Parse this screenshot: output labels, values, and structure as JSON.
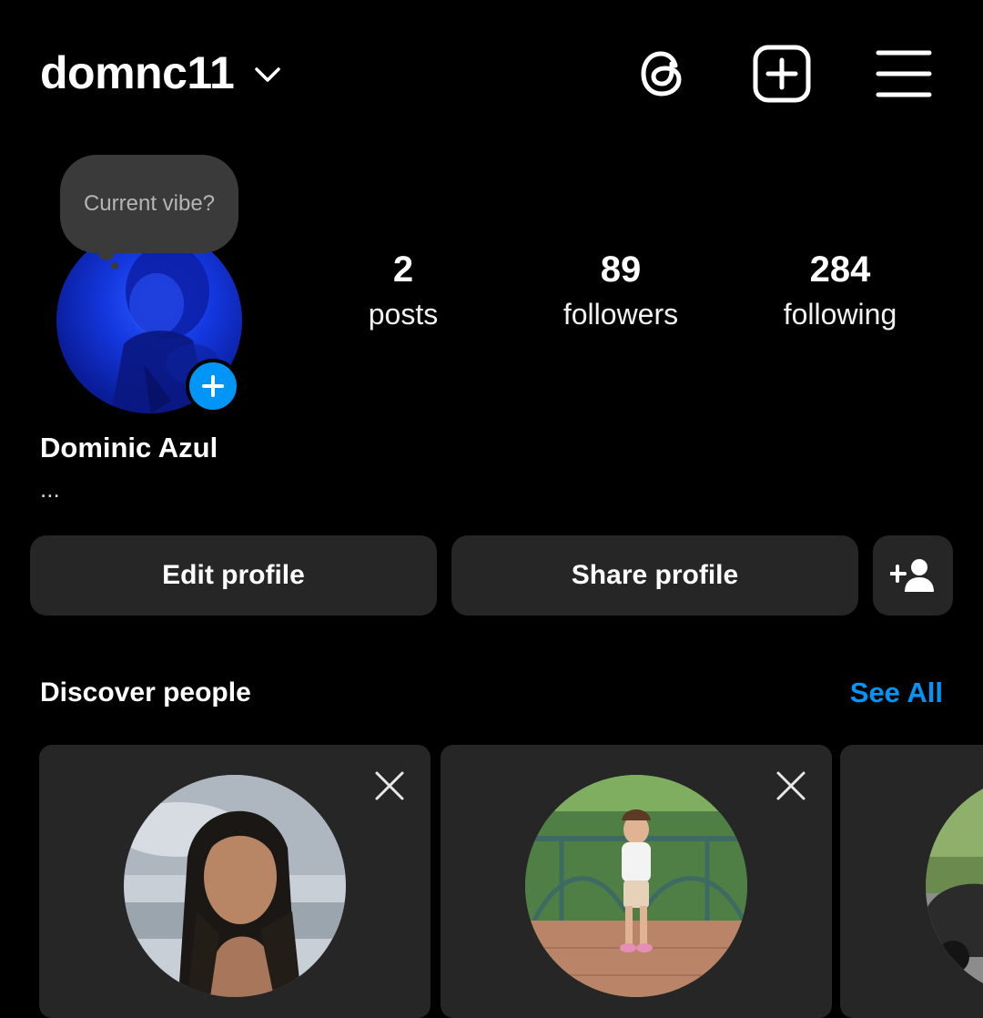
{
  "header": {
    "username": "domnc11",
    "icons": {
      "account_switch": "chevron-down-icon",
      "threads": "threads-icon",
      "create": "plus-square-icon",
      "menu": "hamburger-menu-icon"
    }
  },
  "profile": {
    "note_prompt": "Current vibe?",
    "display_name": "Dominic Azul",
    "bio": "...",
    "stats": [
      {
        "value": "2",
        "label": "posts"
      },
      {
        "value": "89",
        "label": "followers"
      },
      {
        "value": "284",
        "label": "following"
      }
    ]
  },
  "actions": {
    "edit_label": "Edit profile",
    "share_label": "Share profile",
    "add_person_icon": "add-person-icon"
  },
  "discover": {
    "title": "Discover people",
    "see_all": "See All",
    "cards": [
      {
        "photo": "portrait of a woman with long dark hair, cloudy sky"
      },
      {
        "photo": "young girl standing in front of a green fence"
      },
      {
        "photo": "partially visible photo with a parked car"
      }
    ]
  },
  "colors": {
    "background": "#000000",
    "surface": "#262626",
    "accent": "#0095f6",
    "text": "#ffffff"
  }
}
